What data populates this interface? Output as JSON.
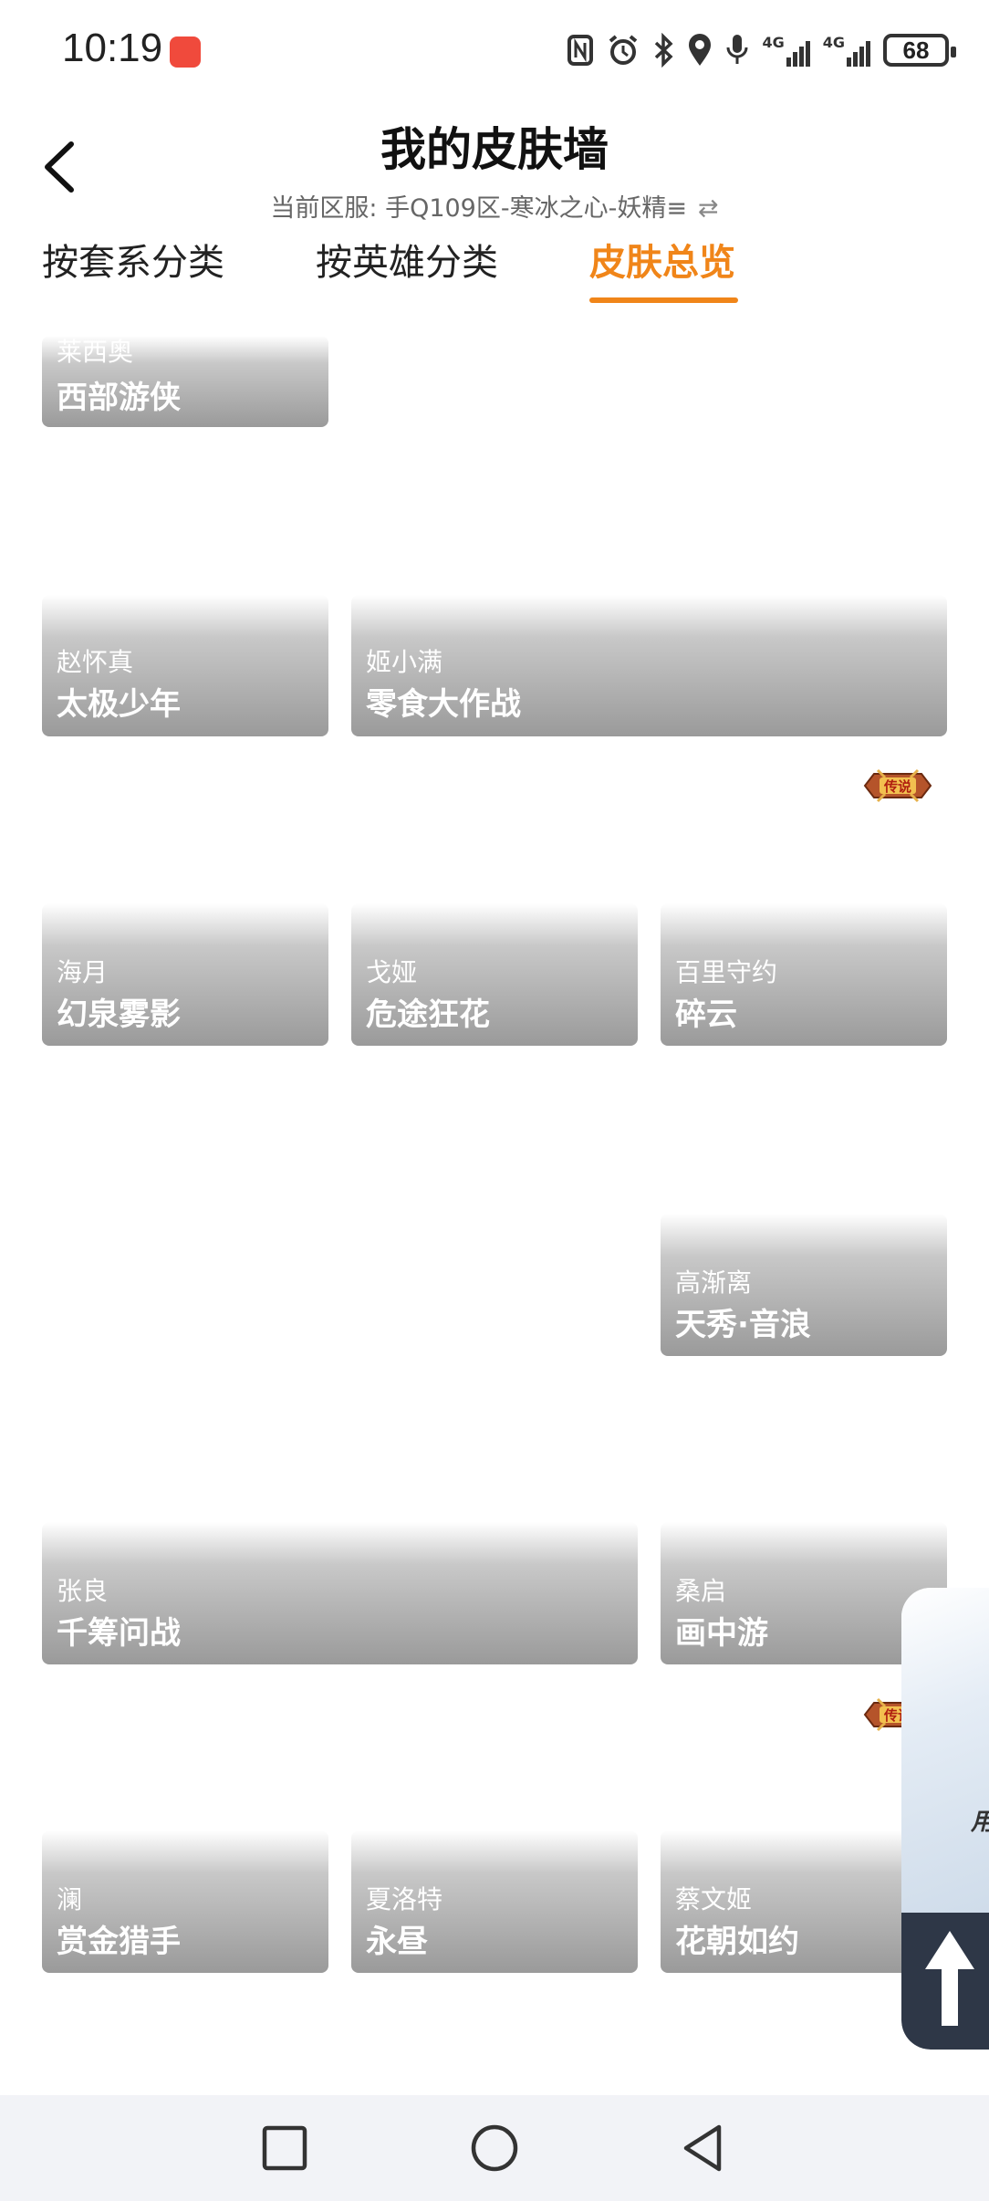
{
  "status_bar": {
    "time": "10:19",
    "network_label_1": "4G",
    "network_label_2": "4G",
    "battery": "68",
    "icons": [
      "red-envelope-app-icon",
      "nfc-icon",
      "alarm-icon",
      "bluetooth-icon",
      "location-icon",
      "microphone-icon",
      "signal-4g-icon",
      "signal-4g-icon",
      "battery-icon"
    ]
  },
  "header": {
    "title": "我的皮肤墙",
    "server": "当前区服: 手Q109区-寒冰之心-妖精≡",
    "swap_symbol": "⇄"
  },
  "tabs": [
    {
      "label": "按套系分类",
      "active": false
    },
    {
      "label": "按英雄分类",
      "active": false
    },
    {
      "label": "皮肤总览",
      "active": true
    }
  ],
  "skins": [
    {
      "hero": "莱西奥",
      "skin": "西部游侠"
    },
    {
      "hero": "赵怀真",
      "skin": "太极少年"
    },
    {
      "hero": "姬小满",
      "skin": "零食大作战"
    },
    {
      "hero": "海月",
      "skin": "幻泉雾影"
    },
    {
      "hero": "戈娅",
      "skin": "危途狂花"
    },
    {
      "hero": "百里守约",
      "skin": "碎云"
    },
    {
      "hero": "高渐离",
      "skin": "天秀·音浪"
    },
    {
      "hero": "张良",
      "skin": "千筹问战"
    },
    {
      "hero": "桑启",
      "skin": "画中游"
    },
    {
      "hero": "澜",
      "skin": "赏金猎手"
    },
    {
      "hero": "夏洛特",
      "skin": "永昼"
    },
    {
      "hero": "蔡文姬",
      "skin": "花朝如约"
    }
  ],
  "badges": {
    "legend_label": "传说"
  },
  "float_widget": {
    "text": "用"
  },
  "nav_bar": {
    "icons": [
      "recent-apps-icon",
      "home-icon",
      "back-icon"
    ]
  },
  "colors": {
    "accent": "#f08519",
    "card_gradient_end": "#9a9a9a",
    "widget_dark": "#2e3747"
  }
}
